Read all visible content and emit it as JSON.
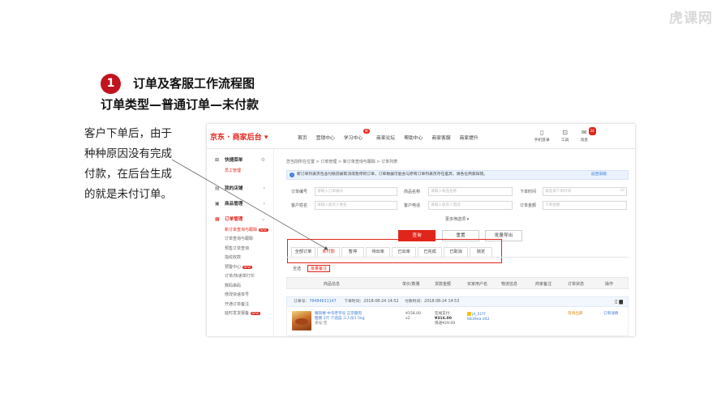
{
  "slide": {
    "watermark": "虎课网",
    "step_number": "1",
    "title": "订单及客服工作流程图",
    "subtitle": "订单类型—普通订单—未付款",
    "description": "客户下单后，由于种种原因没有完成付款，在后台生成的就是未付订单。"
  },
  "app": {
    "brand": "京东 · 商家后台 ▾",
    "nav": [
      {
        "label": "首页"
      },
      {
        "label": "营销中心"
      },
      {
        "label": "学习中心",
        "badge": "新"
      },
      {
        "label": "商家论坛"
      },
      {
        "label": "帮助中心"
      },
      {
        "label": "商家客服"
      },
      {
        "label": "商家提升"
      }
    ],
    "tools": [
      {
        "label": "手机登录",
        "icon": "phone-icon"
      },
      {
        "label": "工具",
        "icon": "briefcase-icon"
      },
      {
        "label": "消息",
        "icon": "message-icon",
        "count": "34"
      }
    ],
    "sidebar": {
      "quick_menu": "快捷菜单",
      "staff_manage": "员工管理",
      "my_store": "我的店铺",
      "goods_manage": "商品管理",
      "order_manage": "订单管理",
      "order_items": [
        {
          "label": "新订单查询与跟踪",
          "badge": "NEW",
          "active": true
        },
        {
          "label": "订单查询与跟踪"
        },
        {
          "label": "预售订单查询"
        },
        {
          "label": "指纹收款"
        },
        {
          "label": "预警中心",
          "badge": "NEW"
        },
        {
          "label": "订单/快递单打印"
        },
        {
          "label": "数码串码"
        },
        {
          "label": "修改快递单号"
        },
        {
          "label": "开通订单备注"
        },
        {
          "label": "延时发货报备",
          "badge": "NEW"
        }
      ]
    },
    "breadcrumb": "您当前所在位置 > 订单管理 > 新订单查询与跟踪 > 订单列表",
    "notice": {
      "text": "新订单列表页包含付款前被取消或暂停的订单，订单数据可能会与原有订单列表页存在差异，请各位商家知晓。",
      "link": "返回旧版"
    },
    "filters": {
      "row1": [
        {
          "label": "订单编号",
          "placeholder": "请输入订单编号"
        },
        {
          "label": "商品名称",
          "placeholder": "请输入商品名称"
        },
        {
          "label": "下单时间",
          "placeholder": "请选择下单时间"
        }
      ],
      "row2": [
        {
          "label": "客户姓名",
          "placeholder": "请输入收货人姓名"
        },
        {
          "label": "客户电话",
          "placeholder": "请输入收货人电话"
        },
        {
          "label": "订单金额",
          "placeholder": "下单金额"
        }
      ],
      "more": "更多筛选项 ▾"
    },
    "buttons": {
      "search": "查询",
      "reset": "重置",
      "export": "批量导出"
    },
    "tabs": [
      "全部订单",
      "未付款",
      "暂停",
      "待出库",
      "已出库",
      "已完成",
      "已取消",
      "锁定"
    ],
    "subtabs": {
      "all": "全选",
      "batch_note": "批量备注"
    },
    "table_headers": [
      "商品信息",
      "单价/数量",
      "货款金额",
      "买家用户名",
      "物流信息",
      "商家备注",
      "订单状态",
      "操作"
    ],
    "order": {
      "order_no_label": "订单号：",
      "order_no": "78484631147",
      "order_time": "下单时间：2018-08-24 14:52",
      "pay_time": "付款时间：2018-08-24 14:53",
      "product_title": "臻同楼 中华老字号 正宗腊肉腊肠 2斤 下酒菜 三人份1.5kg",
      "product_no": "货号:无",
      "price": "¥158.00",
      "qty": "x2",
      "pay_method": "在线支付",
      "total": "¥316.00",
      "shipping": "快递¥29.00",
      "buyer": "jd_51f7 6839ea d42",
      "status": "等待出库",
      "action": "订单详情"
    }
  }
}
